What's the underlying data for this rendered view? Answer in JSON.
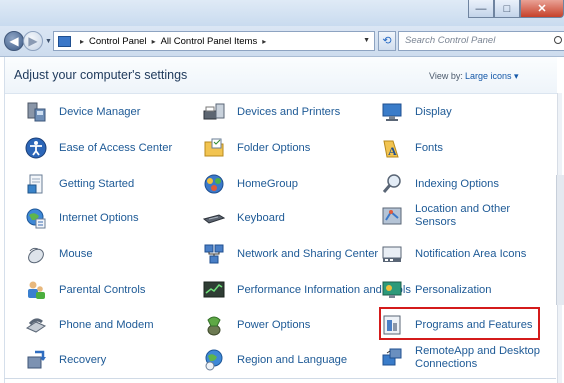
{
  "window": {
    "minimize_glyph": "—",
    "maximize_glyph": "□",
    "close_glyph": "✕"
  },
  "nav": {
    "back_glyph": "◀",
    "forward_glyph": "▶",
    "breadcrumb": [
      "Control Panel",
      "All Control Panel Items"
    ],
    "separator": "▸",
    "refresh_glyph": "⟲",
    "search_placeholder": "Search Control Panel"
  },
  "header": {
    "title": "Adjust your computer's settings",
    "view_by_label": "View by:",
    "view_by_value": "Large icons ▾"
  },
  "items": [
    {
      "label": "Device Manager",
      "icon": "device-manager-icon"
    },
    {
      "label": "Devices and Printers",
      "icon": "devices-printers-icon"
    },
    {
      "label": "Display",
      "icon": "display-icon"
    },
    {
      "label": "Ease of Access Center",
      "icon": "ease-of-access-icon"
    },
    {
      "label": "Folder Options",
      "icon": "folder-options-icon"
    },
    {
      "label": "Fonts",
      "icon": "fonts-icon"
    },
    {
      "label": "Getting Started",
      "icon": "getting-started-icon"
    },
    {
      "label": "HomeGroup",
      "icon": "homegroup-icon"
    },
    {
      "label": "Indexing Options",
      "icon": "indexing-icon"
    },
    {
      "label": "Internet Options",
      "icon": "internet-options-icon"
    },
    {
      "label": "Keyboard",
      "icon": "keyboard-icon"
    },
    {
      "label": "Location and Other Sensors",
      "icon": "location-sensors-icon"
    },
    {
      "label": "Mouse",
      "icon": "mouse-icon"
    },
    {
      "label": "Network and Sharing Center",
      "icon": "network-sharing-icon"
    },
    {
      "label": "Notification Area Icons",
      "icon": "notification-area-icon"
    },
    {
      "label": "Parental Controls",
      "icon": "parental-controls-icon"
    },
    {
      "label": "Performance Information and Tools",
      "icon": "performance-icon"
    },
    {
      "label": "Personalization",
      "icon": "personalization-icon"
    },
    {
      "label": "Phone and Modem",
      "icon": "phone-modem-icon"
    },
    {
      "label": "Power Options",
      "icon": "power-options-icon"
    },
    {
      "label": "Programs and Features",
      "icon": "programs-features-icon"
    },
    {
      "label": "Recovery",
      "icon": "recovery-icon"
    },
    {
      "label": "Region and Language",
      "icon": "region-language-icon"
    },
    {
      "label": "RemoteApp and Desktop Connections",
      "icon": "remoteapp-icon"
    }
  ],
  "colors": {
    "link": "#1e5a96",
    "highlight_border": "#d41b1b"
  }
}
